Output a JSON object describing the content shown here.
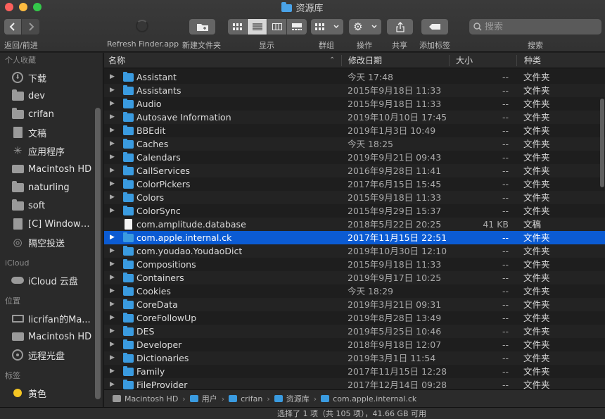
{
  "window": {
    "title": "资源库"
  },
  "toolbar": {
    "back_forward_label": "返回/前进",
    "refresh_label": "Refresh Finder.app",
    "new_folder_label": "新建文件夹",
    "view_label": "显示",
    "group_label": "群组",
    "action_label": "操作",
    "share_label": "共享",
    "tag_label": "添加标签",
    "search_label": "搜索",
    "search_placeholder": "搜索"
  },
  "sidebar": {
    "favorites_title": "个人收藏",
    "favorites": [
      {
        "label": "下载",
        "icon": "download-icon"
      },
      {
        "label": "dev",
        "icon": "folder-icon"
      },
      {
        "label": "crifan",
        "icon": "folder-icon"
      },
      {
        "label": "文稿",
        "icon": "document-icon"
      },
      {
        "label": "应用程序",
        "icon": "applications-icon"
      },
      {
        "label": "Macintosh HD",
        "icon": "drive-icon"
      },
      {
        "label": "naturling",
        "icon": "folder-icon"
      },
      {
        "label": "soft",
        "icon": "folder-icon"
      },
      {
        "label": "[C] Windows...",
        "icon": "document-icon"
      },
      {
        "label": "隔空投送",
        "icon": "airdrop-icon"
      }
    ],
    "icloud_title": "iCloud",
    "icloud": [
      {
        "label": "iCloud 云盘",
        "icon": "cloud-icon"
      }
    ],
    "locations_title": "位置",
    "locations": [
      {
        "label": "licrifan的Ma...",
        "icon": "laptop-icon"
      },
      {
        "label": "Macintosh HD",
        "icon": "drive-icon"
      },
      {
        "label": "远程光盘",
        "icon": "disc-icon"
      }
    ],
    "tags_title": "标签",
    "tags": [
      {
        "label": "黄色",
        "color": "#f5c623"
      }
    ]
  },
  "columns": {
    "name": "名称",
    "date": "修改日期",
    "size": "大小",
    "kind": "种类"
  },
  "files": [
    {
      "name": "Assistant",
      "date": "今天 17:48",
      "size": "--",
      "kind": "文件夹",
      "type": "folder"
    },
    {
      "name": "Assistants",
      "date": "2015年9月18日 11:33",
      "size": "--",
      "kind": "文件夹",
      "type": "folder"
    },
    {
      "name": "Audio",
      "date": "2015年9月18日 11:33",
      "size": "--",
      "kind": "文件夹",
      "type": "folder"
    },
    {
      "name": "Autosave Information",
      "date": "2019年10月10日 17:45",
      "size": "--",
      "kind": "文件夹",
      "type": "folder"
    },
    {
      "name": "BBEdit",
      "date": "2019年1月3日 10:49",
      "size": "--",
      "kind": "文件夹",
      "type": "folder"
    },
    {
      "name": "Caches",
      "date": "今天 18:25",
      "size": "--",
      "kind": "文件夹",
      "type": "folder"
    },
    {
      "name": "Calendars",
      "date": "2019年9月21日 09:43",
      "size": "--",
      "kind": "文件夹",
      "type": "folder"
    },
    {
      "name": "CallServices",
      "date": "2016年9月28日 11:41",
      "size": "--",
      "kind": "文件夹",
      "type": "folder"
    },
    {
      "name": "ColorPickers",
      "date": "2017年6月15日 15:45",
      "size": "--",
      "kind": "文件夹",
      "type": "folder"
    },
    {
      "name": "Colors",
      "date": "2015年9月18日 11:33",
      "size": "--",
      "kind": "文件夹",
      "type": "folder"
    },
    {
      "name": "ColorSync",
      "date": "2015年9月29日 15:37",
      "size": "--",
      "kind": "文件夹",
      "type": "folder"
    },
    {
      "name": "com.amplitude.database",
      "date": "2018年5月22日 20:25",
      "size": "41 KB",
      "kind": "文稿",
      "type": "document"
    },
    {
      "name": "com.apple.internal.ck",
      "date": "2017年11月15日 22:51",
      "size": "--",
      "kind": "文件夹",
      "type": "folder",
      "selected": true
    },
    {
      "name": "com.youdao.YoudaoDict",
      "date": "2019年10月30日 12:10",
      "size": "--",
      "kind": "文件夹",
      "type": "folder"
    },
    {
      "name": "Compositions",
      "date": "2015年9月18日 11:33",
      "size": "--",
      "kind": "文件夹",
      "type": "folder"
    },
    {
      "name": "Containers",
      "date": "2019年9月17日 10:25",
      "size": "--",
      "kind": "文件夹",
      "type": "folder"
    },
    {
      "name": "Cookies",
      "date": "今天 18:29",
      "size": "--",
      "kind": "文件夹",
      "type": "folder"
    },
    {
      "name": "CoreData",
      "date": "2019年3月21日 09:31",
      "size": "--",
      "kind": "文件夹",
      "type": "folder"
    },
    {
      "name": "CoreFollowUp",
      "date": "2019年8月28日 13:49",
      "size": "--",
      "kind": "文件夹",
      "type": "folder"
    },
    {
      "name": "DES",
      "date": "2019年5月25日 10:46",
      "size": "--",
      "kind": "文件夹",
      "type": "folder"
    },
    {
      "name": "Developer",
      "date": "2018年9月18日 12:07",
      "size": "--",
      "kind": "文件夹",
      "type": "folder"
    },
    {
      "name": "Dictionaries",
      "date": "2019年3月1日 11:54",
      "size": "--",
      "kind": "文件夹",
      "type": "folder"
    },
    {
      "name": "Family",
      "date": "2017年11月15日 12:28",
      "size": "--",
      "kind": "文件夹",
      "type": "folder"
    },
    {
      "name": "FileProvider",
      "date": "2017年12月14日 09:28",
      "size": "--",
      "kind": "文件夹",
      "type": "folder"
    }
  ],
  "path": [
    {
      "label": "Macintosh HD",
      "icon": "drive-icon"
    },
    {
      "label": "用户",
      "icon": "folder-icon"
    },
    {
      "label": "crifan",
      "icon": "home-icon"
    },
    {
      "label": "资源库",
      "icon": "folder-icon"
    },
    {
      "label": "com.apple.internal.ck",
      "icon": "folder-icon"
    }
  ],
  "status": "选择了 1 项（共 105 项），41.66 GB 可用",
  "colors": {
    "selection": "#0b5bd3",
    "folder": "#3a9be0",
    "tag_yellow": "#f5c623"
  }
}
